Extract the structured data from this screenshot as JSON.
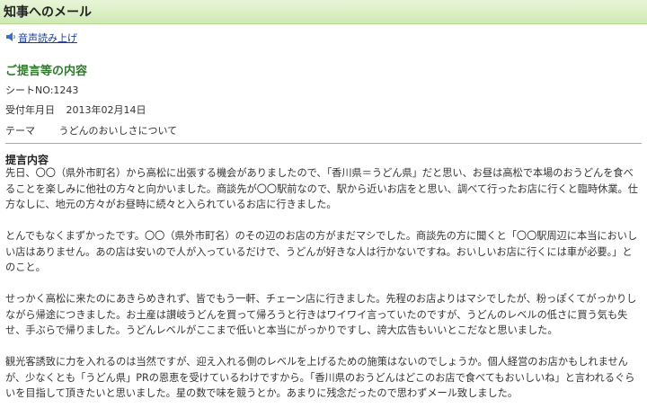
{
  "header": {
    "title": "知事へのメール"
  },
  "audio": {
    "label": "音声読み上げ",
    "icon": "speaker-icon"
  },
  "section": {
    "title": "ご提言等の内容"
  },
  "meta": {
    "sheet_no": "シートNO:1243",
    "date_label": "受付年月日",
    "date_value": "2013年02月14日",
    "theme_label": "テーマ",
    "theme_value": "うどんのおいしさについて"
  },
  "proposal": {
    "heading": "提言内容",
    "paragraphs": [
      "先日、〇〇（県外市町名）から高松に出張する機会がありましたので、「香川県＝うどん県」だと思い、お昼は高松で本場のおうどんを食べることを楽しみに他社の方々と向かいました。商談先が〇〇駅前なので、駅から近いお店をと思い、調べて行ったお店に行くと臨時休業。仕方なしに、地元の方々がお昼時に続々と入られているお店に行きました。",
      "とんでもなくまずかったです。〇〇（県外市町名）のその辺のお店の方がまだマシでした。商談先の方に聞くと「〇〇駅周辺に本当においしい店はありません。あの店は安いので人が入っているだけで、うどんが好きな人は行かないですね。おいしいお店に行くには車が必要。」とのこと。",
      "せっかく高松に来たのにあきらめきれず、皆でもう一軒、チェーン店に行きました。先程のお店よりはマシでしたが、粉っぽくてがっかりしながら帰途につきました。お土産は讃岐うどんを買って帰ろうと行きはワイワイ言っていたのですが、うどんのレベルの低さに買う気も失せ、手ぶらで帰りました。うどんレベルがここまで低いと本当にがっかりですし、誇大広告もいいとこだなと思いました。",
      "観光客誘致に力を入れるのは当然ですが、迎え入れる側のレベルを上げるための施策はないのでしょうか。個人経営のお店かもしれませんが、少なくとも「うどん県」PRの恩恵を受けているわけですから。「香川県のおうどんはどこのお店で食べてもおいしいね」と言われるぐらいを目指して頂きたいと思いました。星の数で味を競うとか。あまりに残念だったので思わずメール致しました。"
    ]
  }
}
